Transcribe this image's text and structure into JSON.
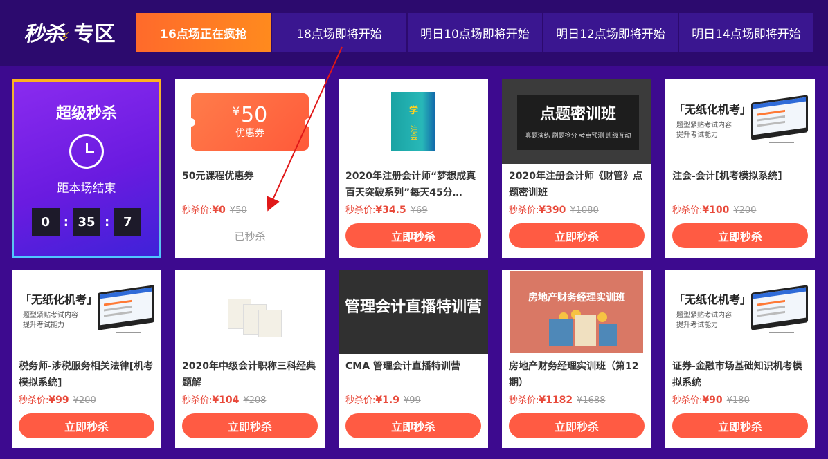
{
  "logo": {
    "text_ms": "秒杀",
    "text_zq": "专区"
  },
  "tabs": [
    {
      "label": "16点场正在疯抢",
      "active": true
    },
    {
      "label": "18点场即将开始",
      "active": false
    },
    {
      "label": "明日10点场即将开始",
      "active": false
    },
    {
      "label": "明日12点场即将开始",
      "active": false
    },
    {
      "label": "明日14点场即将开始",
      "active": false
    }
  ],
  "super": {
    "title": "超级秒杀",
    "subtitle": "距本场结束",
    "hours": "0",
    "minutes": "35",
    "seconds": "7"
  },
  "price_label": "秒杀价:",
  "buy_label": "立即秒杀",
  "sold_label": "已秒杀",
  "coupon": {
    "currency": "¥",
    "amount": "50",
    "label": "优惠券"
  },
  "banners": {
    "dianti": {
      "title": "点题密训班",
      "sub": "真题演练  刷题抢分  考点预测  班级互动"
    },
    "paperless_title": "「无纸化机考」",
    "paperless_sub1": "题型紧贴考试内容",
    "paperless_sub2": "提升考试能力",
    "cma": "管理会计直播特训营",
    "realestate": "房地产财务经理实训班"
  },
  "products": [
    {
      "title": "50元课程优惠券",
      "price": "¥0",
      "old": "¥50"
    },
    {
      "title": "2020年注册会计师“梦想成真百天突破系列”每天45分…",
      "price": "¥34.5",
      "old": "¥69"
    },
    {
      "title": "2020年注册会计师《财管》点题密训班",
      "price": "¥390",
      "old": "¥1080"
    },
    {
      "title": "注会-会计[机考模拟系统]",
      "price": "¥100",
      "old": "¥200"
    },
    {
      "title": "税务师-涉税服务相关法律[机考模拟系统]",
      "price": "¥99",
      "old": "¥200"
    },
    {
      "title": "2020年中级会计职称三科经典题解",
      "price": "¥104",
      "old": "¥208"
    },
    {
      "title": "CMA 管理会计直播特训营",
      "price": "¥1.9",
      "old": "¥99"
    },
    {
      "title": "房地产财务经理实训班（第12期）",
      "price": "¥1182",
      "old": "¥1688"
    },
    {
      "title": "证券-金融市场基础知识机考模拟系统",
      "price": "¥90",
      "old": "¥180"
    }
  ],
  "colors": {
    "bg": "#3d0a8f",
    "topbar": "#2c0a6e",
    "tab": "#3a1690",
    "accent": "#ff5b43",
    "arrow": "#e01818"
  }
}
